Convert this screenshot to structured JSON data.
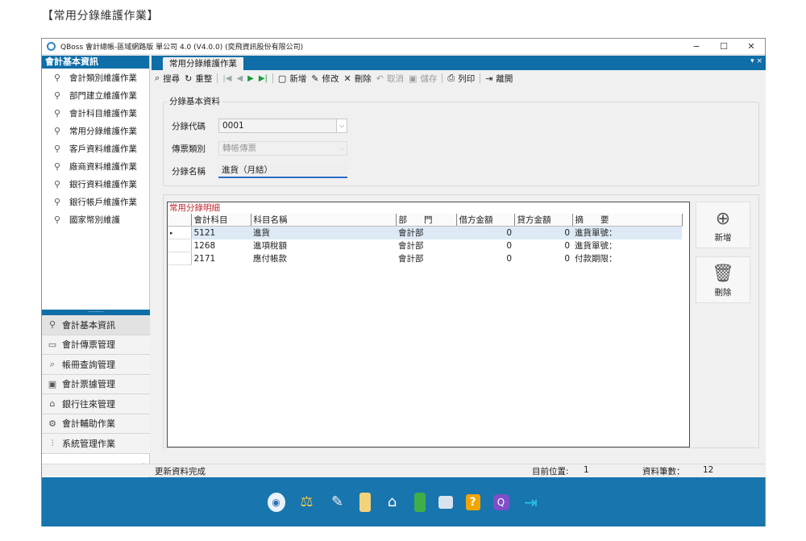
{
  "page_heading": "【常用分錄維護作業】",
  "window": {
    "title": "QBoss 會計總帳-區域網路版 單公司 4.0 (V4.0.0) (奕飛資訊股份有限公司)",
    "controls": {
      "minimize": "−",
      "maximize": "☐",
      "close": "✕"
    }
  },
  "sidebar": {
    "header": "會計基本資訊",
    "items": [
      {
        "label": "會計類別維護作業"
      },
      {
        "label": "部門建立維護作業"
      },
      {
        "label": "會計科目維護作業"
      },
      {
        "label": "常用分錄維護作業"
      },
      {
        "label": "客戶資料維護作業"
      },
      {
        "label": "廠商資料維護作業"
      },
      {
        "label": "銀行資料維護作業"
      },
      {
        "label": "銀行帳戶維護作業"
      },
      {
        "label": "國家幣別維護"
      }
    ],
    "splitter": "..........",
    "modules": [
      {
        "label": "會計基本資訊",
        "icon": "person-icon",
        "glyph": "⚲"
      },
      {
        "label": "會計傳票管理",
        "icon": "folder-icon",
        "glyph": "▭"
      },
      {
        "label": "帳冊查詢管理",
        "icon": "search-icon",
        "glyph": "⌕"
      },
      {
        "label": "會計票據管理",
        "icon": "cheque-icon",
        "glyph": "▣"
      },
      {
        "label": "銀行往來管理",
        "icon": "bank-icon",
        "glyph": "⌂"
      },
      {
        "label": "會計輔助作業",
        "icon": "cog-icon",
        "glyph": "⚙"
      },
      {
        "label": "系統管理作業",
        "icon": "sliders-icon",
        "glyph": "⫶"
      }
    ],
    "collapse": "»"
  },
  "tab": {
    "label": "常用分錄維護作業",
    "close": "▾ ×"
  },
  "toolbar": {
    "search": "搜尋",
    "reset": "重整",
    "add": "新增",
    "edit": "修改",
    "delete": "刪除",
    "cancel": "取消",
    "save": "儲存",
    "print": "列印",
    "exit": "離開"
  },
  "form": {
    "group_title": "分錄基本資料",
    "code_label": "分錄代碼",
    "code_value": "0001",
    "type_label": "傳票類別",
    "type_value": "轉帳傳票",
    "name_label": "分錄名稱",
    "name_value": "進貨（月結）"
  },
  "detail": {
    "title": "常用分錄明細",
    "columns": [
      "會計科目",
      "科目名稱",
      "部　　門",
      "借方金額",
      "貸方金額",
      "摘　　要"
    ],
    "rows": [
      {
        "account": "5121",
        "name": "進貨",
        "dept": "會計部",
        "debit": "0",
        "credit": "0",
        "memo": "進貨單號："
      },
      {
        "account": "1268",
        "name": "進項稅額",
        "dept": "會計部",
        "debit": "0",
        "credit": "0",
        "memo": "進貨單號："
      },
      {
        "account": "2171",
        "name": "應付帳款",
        "dept": "會計部",
        "debit": "0",
        "credit": "0",
        "memo": "付款期限："
      }
    ],
    "row_indicator": "▸",
    "add_label": "新增",
    "delete_label": "刪除"
  },
  "status": {
    "message": "更新資料完成",
    "position_label": "目前位置:",
    "position_value": "1",
    "count_label": "資料筆數：",
    "count_value": "12"
  },
  "taskbar_icons": [
    "mascot-icon",
    "scales-icon",
    "pen-icon",
    "document-icon",
    "bank-icon",
    "cash-icon",
    "gear-folder-icon",
    "help-icon",
    "qboss-icon",
    "exit-icon"
  ]
}
